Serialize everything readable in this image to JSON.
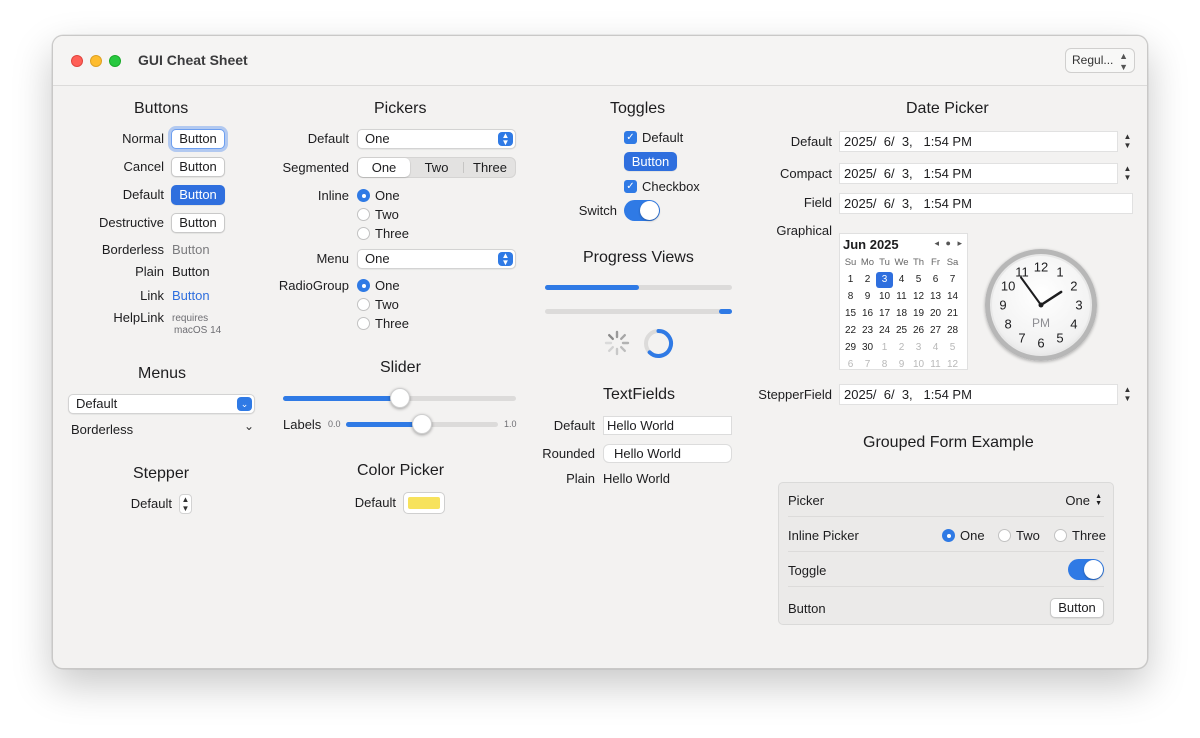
{
  "window": {
    "title": "GUI Cheat Sheet",
    "size_popup": "Regul..."
  },
  "colors": {
    "accent": "#2f7ae5",
    "primary_button": "#2f6fde",
    "link": "#2f6fde",
    "color_well": "#f7e25c"
  },
  "buttons": {
    "title": "Buttons",
    "rows": [
      {
        "label": "Normal",
        "text": "Button"
      },
      {
        "label": "Cancel",
        "text": "Button"
      },
      {
        "label": "Default",
        "text": "Button"
      },
      {
        "label": "Destructive",
        "text": "Button"
      },
      {
        "label": "Borderless",
        "text": "Button"
      },
      {
        "label": "Plain",
        "text": "Button"
      },
      {
        "label": "Link",
        "text": "Button"
      },
      {
        "label": "HelpLink",
        "text_line1": "requires",
        "text_line2": "macOS 14"
      }
    ]
  },
  "menus": {
    "title": "Menus",
    "default_value": "Default",
    "borderless_value": "Borderless"
  },
  "stepper": {
    "title": "Stepper",
    "label": "Default"
  },
  "pickers": {
    "title": "Pickers",
    "default_label": "Default",
    "default_value": "One",
    "segmented_label": "Segmented",
    "segments": [
      "One",
      "Two",
      "Three"
    ],
    "inline_label": "Inline",
    "inline_options": [
      "One",
      "Two",
      "Three"
    ],
    "menu_label": "Menu",
    "menu_value": "One",
    "radiogroup_label": "RadioGroup",
    "radio_options": [
      "One",
      "Two",
      "Three"
    ]
  },
  "slider": {
    "title": "Slider",
    "value_fraction": 0.5,
    "labels_label": "Labels",
    "min_label": "0.0",
    "max_label": "1.0",
    "labels_value_fraction": 0.5
  },
  "color_picker": {
    "title": "Color Picker",
    "label": "Default"
  },
  "toggles": {
    "title": "Toggles",
    "default_label": "Default",
    "button_label": "Button",
    "checkbox_label": "Checkbox",
    "switch_label": "Switch"
  },
  "progress": {
    "title": "Progress Views",
    "bar1_fraction": 0.5,
    "bar2_fraction": 0.07
  },
  "textfields": {
    "title": "TextFields",
    "rows": [
      {
        "label": "Default",
        "value": "Hello World"
      },
      {
        "label": "Rounded",
        "value": "Hello World"
      },
      {
        "label": "Plain",
        "value": "Hello World"
      }
    ]
  },
  "datepicker": {
    "title": "Date Picker",
    "default_label": "Default",
    "compact_label": "Compact",
    "field_label": "Field",
    "graphical_label": "Graphical",
    "stepperfield_label": "StepperField",
    "value": "2025/  6/  3,   1:54 PM",
    "calendar": {
      "month": "Jun 2025",
      "nav": "◂ ● ▸",
      "weekdays": [
        "Su",
        "Mo",
        "Tu",
        "We",
        "Th",
        "Fr",
        "Sa"
      ],
      "days": [
        [
          "1",
          "2",
          "3",
          "4",
          "5",
          "6",
          "7"
        ],
        [
          "8",
          "9",
          "10",
          "11",
          "12",
          "13",
          "14"
        ],
        [
          "15",
          "16",
          "17",
          "18",
          "19",
          "20",
          "21"
        ],
        [
          "22",
          "23",
          "24",
          "25",
          "26",
          "27",
          "28"
        ],
        [
          "29",
          "30",
          "1",
          "2",
          "3",
          "4",
          "5"
        ],
        [
          "6",
          "7",
          "8",
          "9",
          "10",
          "11",
          "12"
        ]
      ],
      "selected": "3"
    },
    "clock": {
      "numbers": [
        "12",
        "1",
        "2",
        "3",
        "4",
        "5",
        "6",
        "7",
        "8",
        "9",
        "10",
        "11"
      ],
      "ampm": "PM",
      "hour": 1,
      "minute": 54
    }
  },
  "grouped_form": {
    "title": "Grouped Form Example",
    "picker_label": "Picker",
    "picker_value": "One",
    "inline_label": "Inline Picker",
    "inline_options": [
      "One",
      "Two",
      "Three"
    ],
    "toggle_label": "Toggle",
    "button_label": "Button",
    "button_text": "Button"
  }
}
